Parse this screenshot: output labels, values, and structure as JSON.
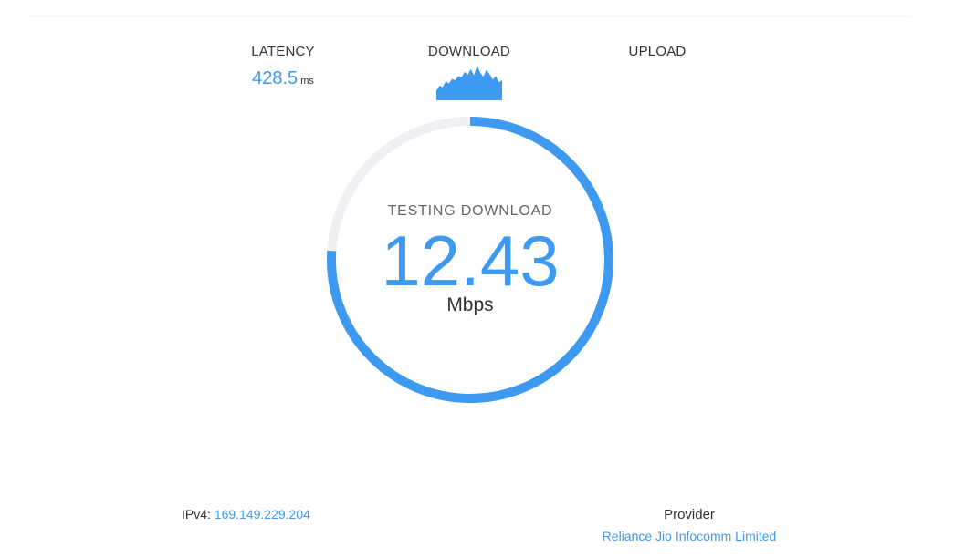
{
  "colors": {
    "accent": "#3e99f0",
    "track": "#eef0f4",
    "text": "#333333"
  },
  "metrics": {
    "latency": {
      "label": "LATENCY",
      "value": "428.5",
      "unit": "ms"
    },
    "download": {
      "label": "DOWNLOAD"
    },
    "upload": {
      "label": "UPLOAD"
    }
  },
  "gauge": {
    "status": "TESTING DOWNLOAD",
    "speed": "12.43",
    "unit": "Mbps",
    "progress": 0.76
  },
  "download_sparkline": [
    0.28,
    0.42,
    0.38,
    0.55,
    0.48,
    0.62,
    0.58,
    0.7,
    0.66,
    0.82,
    0.74,
    0.9,
    0.72,
    1.0,
    0.8,
    0.68,
    0.88,
    0.76,
    0.6,
    0.7,
    0.52,
    0.58
  ],
  "footer": {
    "ip_label": "IPv4:",
    "ip_value": "169.149.229.204",
    "provider_label": "Provider",
    "provider_value": "Reliance Jio Infocomm Limited"
  }
}
